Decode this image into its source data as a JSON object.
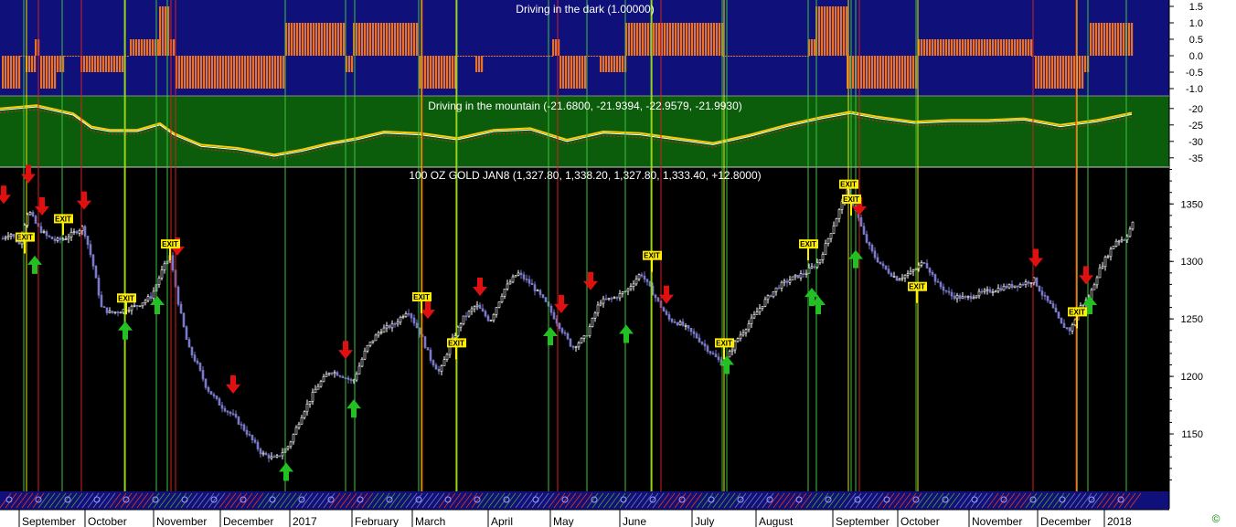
{
  "chart_data": [
    {
      "type": "bar",
      "panel": "indicator-top",
      "title": "Driving in the dark (1.00000)",
      "yticks": [
        "1.5",
        "1.0",
        "0.5",
        "0.0",
        "-0.5",
        "-1.0"
      ],
      "ylim": [
        -1.0,
        1.5
      ],
      "colors": {
        "background": "#10107a",
        "bar": "#e8722a"
      },
      "segments": [
        {
          "x0": 2,
          "x1": 22,
          "v": -1
        },
        {
          "x0": 22,
          "x1": 28,
          "v": 0
        },
        {
          "x0": 28,
          "x1": 38,
          "v": -0.5
        },
        {
          "x0": 38,
          "x1": 44,
          "v": 0.5
        },
        {
          "x0": 44,
          "x1": 62,
          "v": -1
        },
        {
          "x0": 62,
          "x1": 70,
          "v": -0.5
        },
        {
          "x0": 70,
          "x1": 88,
          "v": 0
        },
        {
          "x0": 88,
          "x1": 136,
          "v": -0.5
        },
        {
          "x0": 136,
          "x1": 142,
          "v": 0
        },
        {
          "x0": 142,
          "x1": 174,
          "v": 0.5
        },
        {
          "x0": 174,
          "x1": 186,
          "v": 1.5
        },
        {
          "x0": 186,
          "x1": 192,
          "v": 0.5
        },
        {
          "x0": 192,
          "x1": 312,
          "v": -1
        },
        {
          "x0": 312,
          "x1": 378,
          "v": 1
        },
        {
          "x0": 378,
          "x1": 386,
          "v": -0.5
        },
        {
          "x0": 386,
          "x1": 458,
          "v": 1
        },
        {
          "x0": 458,
          "x1": 500,
          "v": -1
        },
        {
          "x0": 500,
          "x1": 520,
          "v": 0
        },
        {
          "x0": 520,
          "x1": 528,
          "v": -0.5
        },
        {
          "x0": 528,
          "x1": 604,
          "v": 0
        },
        {
          "x0": 604,
          "x1": 612,
          "v": 0.5
        },
        {
          "x0": 612,
          "x1": 640,
          "v": -1
        },
        {
          "x0": 640,
          "x1": 656,
          "v": 0
        },
        {
          "x0": 656,
          "x1": 684,
          "v": -0.5
        },
        {
          "x0": 684,
          "x1": 790,
          "v": 1
        },
        {
          "x0": 790,
          "x1": 884,
          "v": 0
        },
        {
          "x0": 884,
          "x1": 892,
          "v": 0.5
        },
        {
          "x0": 892,
          "x1": 926,
          "v": 1.5
        },
        {
          "x0": 926,
          "x1": 1004,
          "v": -1
        },
        {
          "x0": 1004,
          "x1": 1128,
          "v": 0.5
        },
        {
          "x0": 1128,
          "x1": 1132,
          "v": 0
        },
        {
          "x0": 1132,
          "x1": 1186,
          "v": -1
        },
        {
          "x0": 1186,
          "x1": 1192,
          "v": -0.5
        },
        {
          "x0": 1192,
          "x1": 1238,
          "v": 1
        }
      ]
    },
    {
      "type": "line",
      "panel": "indicator-middle",
      "title": "Driving in the mountain (-21.6800, -21.9394, -22.9579, -21.9930)",
      "yticks": [
        "-20",
        "-25",
        "-30",
        "-35"
      ],
      "ylim": [
        -37,
        -17
      ],
      "colors": {
        "background": "#0b5c0b",
        "main": "#ffffff",
        "signal": "#ffcc00",
        "lower": "#cc2b1a"
      },
      "series": {
        "x": [
          0,
          40,
          80,
          100,
          120,
          150,
          175,
          190,
          220,
          260,
          300,
          330,
          360,
          390,
          420,
          460,
          500,
          540,
          580,
          620,
          660,
          700,
          740,
          780,
          820,
          860,
          900,
          930,
          960,
          1000,
          1040,
          1080,
          1120,
          1160,
          1200,
          1238
        ],
        "y": [
          -20.5,
          -19.5,
          -22.0,
          -26.0,
          -27.0,
          -27.0,
          -25.0,
          -28.0,
          -31.5,
          -32.5,
          -34.5,
          -33.0,
          -31.0,
          -29.5,
          -27.5,
          -28.0,
          -29.5,
          -27.0,
          -26.5,
          -30.0,
          -27.5,
          -28.0,
          -29.5,
          -31.0,
          -28.5,
          -25.5,
          -23.0,
          -21.5,
          -23.0,
          -24.5,
          -24.0,
          -24.0,
          -23.5,
          -25.5,
          -24.0,
          -21.8
        ]
      }
    },
    {
      "type": "candlestick",
      "panel": "price",
      "title": "100 OZ GOLD JAN8 (1,327.80, 1,338.20, 1,327.80, 1,333.40, +12.8000)",
      "yticks": [
        "1350",
        "1300",
        "1250",
        "1200",
        "1150"
      ],
      "ylim": [
        1100,
        1382
      ],
      "xticks": [
        {
          "x": 24,
          "label": "September"
        },
        {
          "x": 96,
          "label": "October"
        },
        {
          "x": 171,
          "label": "November"
        },
        {
          "x": 244,
          "label": "December"
        },
        {
          "x": 320,
          "label": "2017"
        },
        {
          "x": 388,
          "label": "February"
        },
        {
          "x": 454,
          "label": "March"
        },
        {
          "x": 537,
          "label": "April"
        },
        {
          "x": 605,
          "label": "May"
        },
        {
          "x": 681,
          "label": "June"
        },
        {
          "x": 760,
          "label": "July"
        },
        {
          "x": 830,
          "label": "August"
        },
        {
          "x": 914,
          "label": "September"
        },
        {
          "x": 985,
          "label": "October"
        },
        {
          "x": 1063,
          "label": "November"
        },
        {
          "x": 1138,
          "label": "December"
        },
        {
          "x": 1211,
          "label": "2018"
        }
      ],
      "close_path": {
        "x": [
          2,
          10,
          20,
          30,
          40,
          50,
          60,
          70,
          80,
          90,
          100,
          110,
          120,
          135,
          150,
          165,
          175,
          185,
          195,
          205,
          215,
          225,
          240,
          255,
          270,
          285,
          300,
          315,
          330,
          345,
          360,
          375,
          385,
          400,
          415,
          430,
          445,
          460,
          470,
          480,
          490,
          505,
          520,
          535,
          550,
          565,
          580,
          595,
          610,
          625,
          640,
          655,
          670,
          685,
          700,
          715,
          730,
          745,
          760,
          775,
          790,
          805,
          820,
          835,
          850,
          865,
          880,
          895,
          905,
          915,
          925,
          935,
          945,
          955,
          965,
          980,
          995,
          1010,
          1025,
          1040,
          1055,
          1070,
          1085,
          1100,
          1115,
          1130,
          1140,
          1150,
          1160,
          1170,
          1180,
          1190,
          1200,
          1210,
          1220,
          1230,
          1238
        ],
        "y": [
          1320,
          1325,
          1315,
          1345,
          1330,
          1322,
          1318,
          1320,
          1325,
          1330,
          1300,
          1260,
          1255,
          1258,
          1262,
          1270,
          1290,
          1305,
          1260,
          1225,
          1210,
          1190,
          1175,
          1165,
          1150,
          1133,
          1128,
          1140,
          1168,
          1190,
          1205,
          1200,
          1195,
          1225,
          1240,
          1245,
          1258,
          1235,
          1215,
          1203,
          1225,
          1250,
          1262,
          1248,
          1275,
          1290,
          1280,
          1265,
          1245,
          1225,
          1235,
          1265,
          1268,
          1275,
          1290,
          1270,
          1250,
          1245,
          1235,
          1222,
          1210,
          1232,
          1248,
          1265,
          1278,
          1285,
          1290,
          1300,
          1320,
          1340,
          1362,
          1345,
          1320,
          1305,
          1295,
          1285,
          1290,
          1300,
          1280,
          1270,
          1268,
          1272,
          1275,
          1278,
          1280,
          1284,
          1270,
          1260,
          1245,
          1240,
          1260,
          1268,
          1290,
          1305,
          1318,
          1320,
          1333
        ]
      },
      "signals": [
        {
          "x": 4,
          "y": 1350,
          "type": "sell"
        },
        {
          "x": 31,
          "y": 1368,
          "type": "sell"
        },
        {
          "x": 46,
          "y": 1340,
          "type": "sell"
        },
        {
          "x": 92,
          "y": 1345,
          "type": "sell"
        },
        {
          "x": 194,
          "y": 1305,
          "type": "sell"
        },
        {
          "x": 255,
          "y": 1185,
          "type": "sell"
        },
        {
          "x": 378,
          "y": 1215,
          "type": "sell"
        },
        {
          "x": 468,
          "y": 1250,
          "type": "sell"
        },
        {
          "x": 525,
          "y": 1270,
          "type": "sell"
        },
        {
          "x": 614,
          "y": 1255,
          "type": "sell"
        },
        {
          "x": 646,
          "y": 1275,
          "type": "sell"
        },
        {
          "x": 729,
          "y": 1263,
          "type": "sell"
        },
        {
          "x": 940,
          "y": 1340,
          "type": "sell"
        },
        {
          "x": 1133,
          "y": 1295,
          "type": "sell"
        },
        {
          "x": 1188,
          "y": 1280,
          "type": "sell"
        },
        {
          "x": 38,
          "y": 1305,
          "type": "buy"
        },
        {
          "x": 137,
          "y": 1248,
          "type": "buy"
        },
        {
          "x": 172,
          "y": 1270,
          "type": "buy"
        },
        {
          "x": 313,
          "y": 1125,
          "type": "buy"
        },
        {
          "x": 387,
          "y": 1180,
          "type": "buy"
        },
        {
          "x": 602,
          "y": 1243,
          "type": "buy"
        },
        {
          "x": 685,
          "y": 1245,
          "type": "buy"
        },
        {
          "x": 795,
          "y": 1218,
          "type": "buy"
        },
        {
          "x": 888,
          "y": 1277,
          "type": "buy"
        },
        {
          "x": 895,
          "y": 1270,
          "type": "buy"
        },
        {
          "x": 936,
          "y": 1310,
          "type": "buy"
        },
        {
          "x": 1192,
          "y": 1270,
          "type": "buy"
        }
      ],
      "exit_labels": [
        {
          "x": 27,
          "y": 1318,
          "text": "EXIT"
        },
        {
          "x": 69,
          "y": 1334,
          "text": "EXIT"
        },
        {
          "x": 138,
          "y": 1265,
          "text": "EXIT"
        },
        {
          "x": 186,
          "y": 1312,
          "text": "EXIT"
        },
        {
          "x": 461,
          "y": 1266,
          "text": "EXIT"
        },
        {
          "x": 499,
          "y": 1226,
          "text": "EXIT"
        },
        {
          "x": 713,
          "y": 1302,
          "text": "EXIT"
        },
        {
          "x": 792,
          "y": 1226,
          "text": "EXIT"
        },
        {
          "x": 884,
          "y": 1312,
          "text": "EXIT"
        },
        {
          "x": 928,
          "y": 1364,
          "text": "EXIT"
        },
        {
          "x": 931,
          "y": 1351,
          "text": "EXIT"
        },
        {
          "x": 1003,
          "y": 1275,
          "text": "EXIT"
        },
        {
          "x": 1178,
          "y": 1253,
          "text": "EXIT"
        }
      ],
      "vlines": {
        "green": [
          26,
          68,
          136,
          171,
          183,
          312,
          378,
          388,
          458,
          500,
          600,
          642,
          684,
          712,
          790,
          795,
          884,
          893,
          931,
          936,
          1002,
          1190,
          1232
        ],
        "red": [
          42,
          89,
          187,
          192,
          462,
          610,
          723,
          1130,
          1177,
          940
        ],
        "yellow": [
          29,
          137,
          461,
          499,
          713,
          792,
          928,
          1004,
          1178
        ]
      },
      "colors": {
        "background": "#000000",
        "bar_down": "#7a7acc",
        "bar_up": "#ffffff",
        "sell": "#e01010",
        "buy": "#22c022",
        "exit_bg": "#ffee00"
      }
    }
  ],
  "footer": {
    "copyright": "©"
  }
}
